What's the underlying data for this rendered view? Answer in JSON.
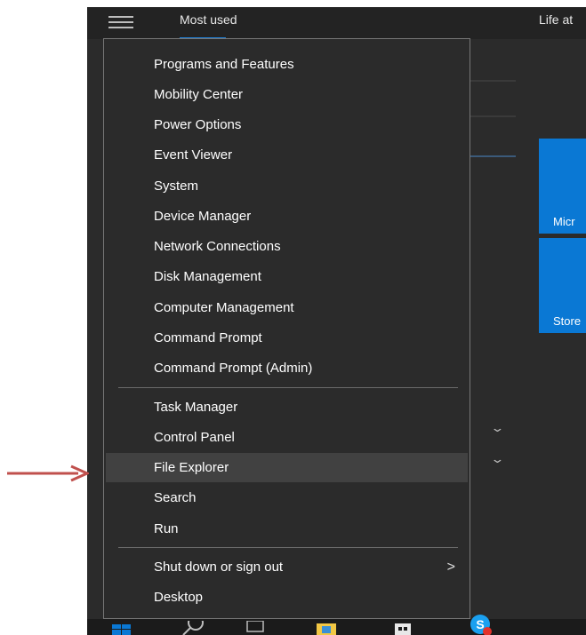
{
  "start_menu": {
    "header_label": "Most used",
    "right_header": "Life at",
    "tiles": [
      {
        "label": "Micr"
      },
      {
        "label": "Store"
      }
    ]
  },
  "context_menu": {
    "groups": [
      {
        "items": [
          {
            "label": "Programs and Features"
          },
          {
            "label": "Mobility Center"
          },
          {
            "label": "Power Options"
          },
          {
            "label": "Event Viewer"
          },
          {
            "label": "System"
          },
          {
            "label": "Device Manager"
          },
          {
            "label": "Network Connections"
          },
          {
            "label": "Disk Management"
          },
          {
            "label": "Computer Management"
          },
          {
            "label": "Command Prompt"
          },
          {
            "label": "Command Prompt (Admin)"
          }
        ]
      },
      {
        "items": [
          {
            "label": "Task Manager"
          },
          {
            "label": "Control Panel"
          },
          {
            "label": "File Explorer",
            "highlighted": true
          },
          {
            "label": "Search"
          },
          {
            "label": "Run"
          }
        ]
      },
      {
        "items": [
          {
            "label": "Shut down or sign out",
            "has_submenu": true
          },
          {
            "label": "Desktop"
          }
        ]
      }
    ]
  },
  "colors": {
    "menu_bg": "#2b2b2b",
    "highlight": "#414141",
    "tile_blue": "#0a78d4",
    "accent": "#1f7fd6",
    "annotation_arrow": "#c0504d"
  },
  "icons": [
    "hamburger-icon",
    "chevron-down-icon",
    "chevron-right-icon",
    "windows-start-icon",
    "search-icon",
    "task-view-icon",
    "file-explorer-icon",
    "store-icon",
    "skype-icon"
  ]
}
